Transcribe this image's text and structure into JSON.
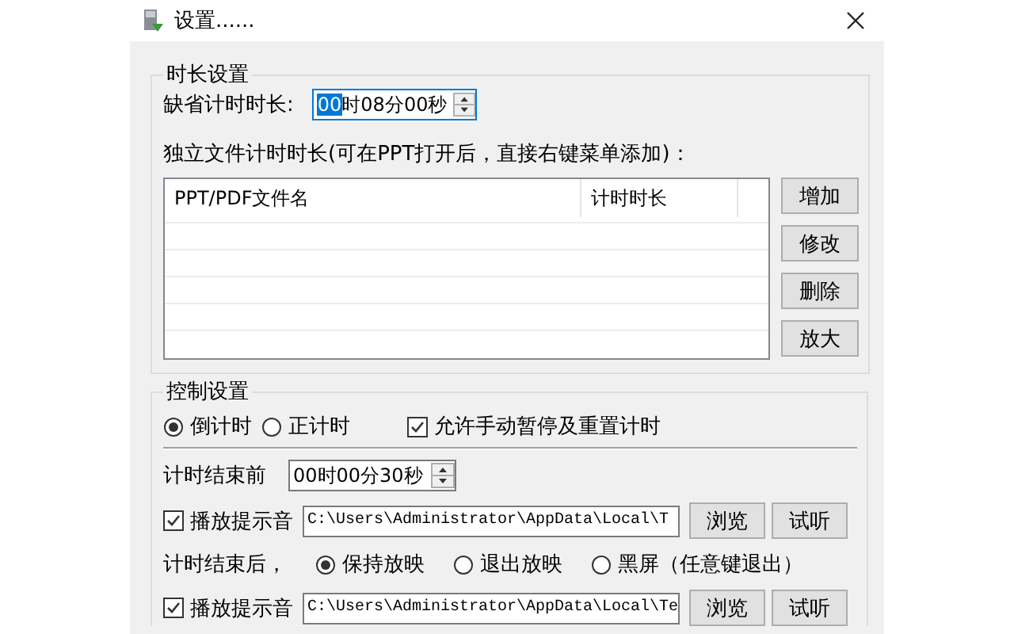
{
  "window": {
    "title": "设置......"
  },
  "duration_group": {
    "legend": "时长设置",
    "default_label": "缺省计时时长:",
    "default_spinner": {
      "value_parts": [
        {
          "text": "00",
          "selected": true
        },
        {
          "text": "时08分00秒",
          "selected": false
        }
      ]
    },
    "table_label": "独立文件计时时长(可在PPT打开后，直接右键菜单添加)：",
    "table": {
      "columns": [
        "PPT/PDF文件名",
        "计时时长"
      ]
    },
    "buttons": [
      "增加",
      "修改",
      "删除",
      "放大"
    ]
  },
  "control_group": {
    "legend": "控制设置",
    "mode_radios": [
      {
        "label": "倒计时",
        "selected": true
      },
      {
        "label": "正计时",
        "selected": false
      }
    ],
    "manual_checkbox": {
      "label": "允许手动暂停及重置计时",
      "checked": true
    },
    "before_end_label": "计时结束前",
    "before_end_spinner": {
      "value": "00时00分30秒"
    },
    "sound_before": {
      "label": "播放提示音",
      "checked": true,
      "path": "C:\\Users\\Administrator\\AppData\\Local\\T",
      "buttons": [
        "浏览",
        "试听"
      ]
    },
    "after_end_label": "计时结束后，",
    "after_end_radios": [
      {
        "label": "保持放映",
        "selected": true
      },
      {
        "label": "退出放映",
        "selected": false
      },
      {
        "label": "黑屏（任意键退出）",
        "selected": false
      }
    ],
    "sound_after": {
      "label": "播放提示音",
      "checked": true,
      "path": "C:\\Users\\Administrator\\AppData\\Local\\Te",
      "buttons": [
        "浏览",
        "试听"
      ]
    }
  }
}
